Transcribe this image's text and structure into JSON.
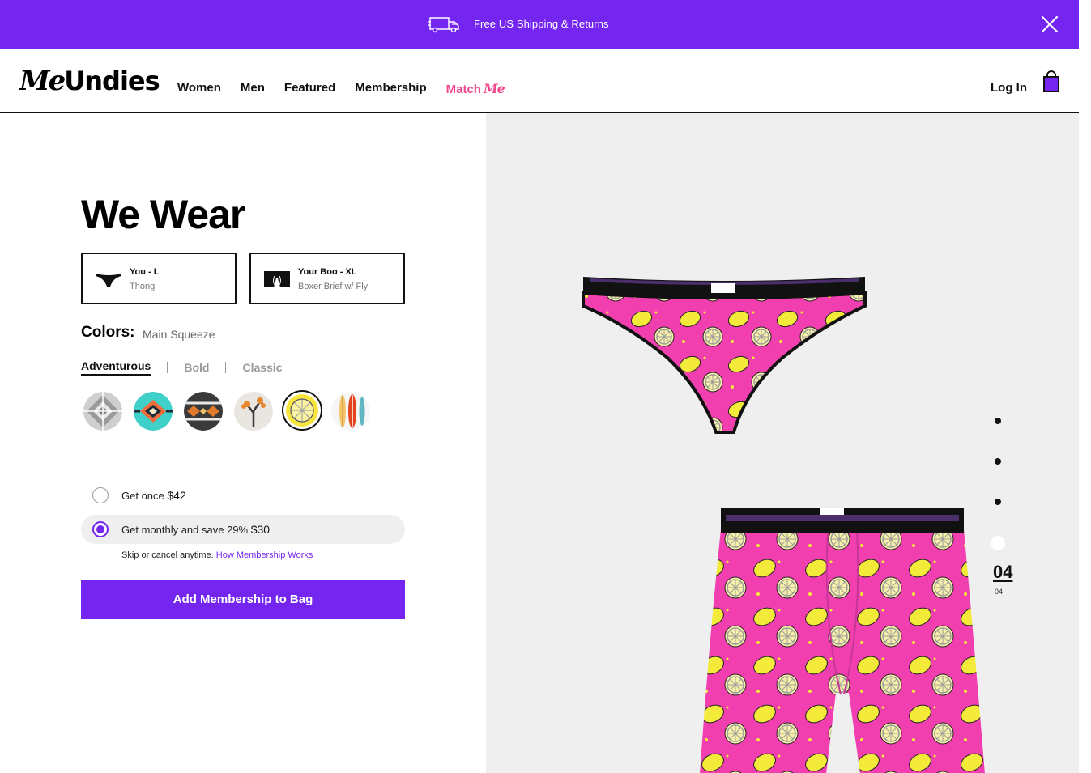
{
  "promo": {
    "text": "Free US Shipping & Returns",
    "icon": "truck-icon",
    "close_icon": "close-icon",
    "bg_color": "#7525f0"
  },
  "header": {
    "logo_me": "Me",
    "logo_undies": "Undies",
    "nav": [
      {
        "label": "Women"
      },
      {
        "label": "Men"
      },
      {
        "label": "Featured"
      },
      {
        "label": "Membership"
      }
    ],
    "match_label": "Match",
    "match_me": "Me",
    "match_color": "#f1498e",
    "login": "Log In",
    "bag_icon": "shopping-bag-icon"
  },
  "product": {
    "title": "We Wear",
    "wearers": [
      {
        "name": "You - L",
        "style": "Thong",
        "icon": "thong-icon"
      },
      {
        "name": "Your Boo - XL",
        "style": "Boxer Brief w/ Fly",
        "icon": "boxer-brief-icon"
      }
    ],
    "colors_label": "Colors:",
    "color_name": "Main Squeeze",
    "categories": [
      {
        "label": "Adventurous",
        "active": true
      },
      {
        "label": "Bold",
        "active": false
      },
      {
        "label": "Classic",
        "active": false
      }
    ],
    "swatches": [
      {
        "name": "grey-geometric",
        "selected": false
      },
      {
        "name": "teal-aztec",
        "selected": false
      },
      {
        "name": "dark-tribal",
        "selected": false
      },
      {
        "name": "joshua-tree",
        "selected": false
      },
      {
        "name": "lemon-main-squeeze",
        "selected": true
      },
      {
        "name": "surfboards",
        "selected": false
      }
    ],
    "purchase_options": [
      {
        "prefix": "Get once",
        "price": "$42",
        "selected": false
      },
      {
        "prefix": "Get monthly and save 29%",
        "price": "$30",
        "selected": true
      }
    ],
    "skip_text": "Skip or cancel anytime.",
    "skip_link": "How Membership Works",
    "cta": "Add Membership to Bag",
    "accent_color": "#7525f0"
  },
  "gallery": {
    "current": "04",
    "total": "04",
    "active_index": 4,
    "slide_count": 4
  }
}
